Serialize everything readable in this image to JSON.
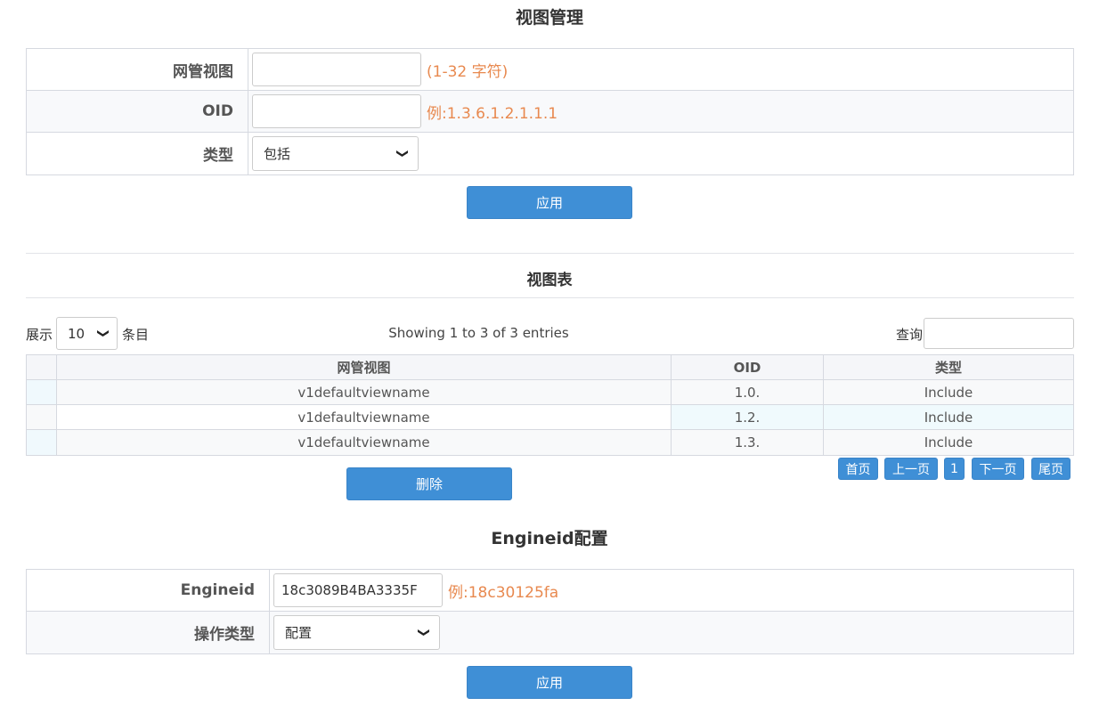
{
  "view_mgmt": {
    "title": "视图管理",
    "fields": {
      "view_label": "网管视图",
      "view_value": "",
      "view_hint": "(1-32 字符)",
      "oid_label": "OID",
      "oid_value": "",
      "oid_hint": "例:1.3.6.1.2.1.1.1",
      "type_label": "类型",
      "type_selected": "包括"
    },
    "apply_label": "应用"
  },
  "view_table": {
    "title": "视图表",
    "length_prefix": "展示",
    "length_value": "10",
    "length_suffix": "条目",
    "info": "Showing 1 to 3 of 3 entries",
    "search_label": "查询",
    "columns": [
      "网管视图",
      "OID",
      "类型"
    ],
    "rows": [
      {
        "name": "v1defaultviewname",
        "oid": "1.0.",
        "type": "Include"
      },
      {
        "name": "v1defaultviewname",
        "oid": "1.2.",
        "type": "Include"
      },
      {
        "name": "v1defaultviewname",
        "oid": "1.3.",
        "type": "Include"
      }
    ],
    "delete_label": "删除",
    "pager": {
      "first": "首页",
      "prev": "上一页",
      "current": "1",
      "next": "下一页",
      "last": "尾页"
    }
  },
  "engineid": {
    "title": "Engineid配置",
    "engineid_label": "Engineid",
    "engineid_value": "18c3089B4BA3335F",
    "engineid_hint": "例:18c30125fa",
    "op_label": "操作类型",
    "op_selected": "配置",
    "apply_label": "应用"
  },
  "colors": {
    "primary_button": "#3f8fd6",
    "hint": "#e8894f"
  }
}
